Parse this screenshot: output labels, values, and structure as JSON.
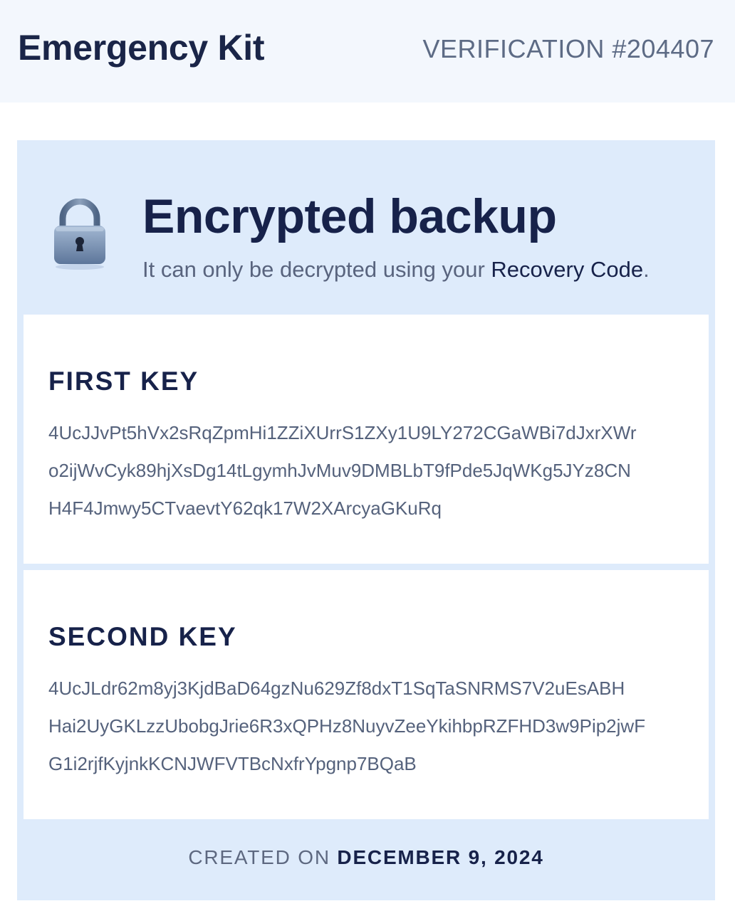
{
  "header": {
    "title": "Emergency Kit",
    "verification": "VERIFICATION #204407"
  },
  "backup": {
    "icon": "lock-icon",
    "title": "Encrypted backup",
    "subtitle_prefix": "It can only be decrypted using your ",
    "subtitle_emphasis": "Recovery Code",
    "subtitle_suffix": "."
  },
  "keys": [
    {
      "label": "FIRST KEY",
      "lines": [
        "4UcJJvPt5hVx2sRqZpmHi1ZZiXUrrS1ZXy1U9LY272CGaWBi7dJxrXWr",
        "o2ijWvCyk89hjXsDg14tLgymhJvMuv9DMBLbT9fPde5JqWKg5JYz8CN",
        "H4F4Jmwy5CTvaevtY62qk17W2XArcyaGKuRq"
      ]
    },
    {
      "label": "SECOND KEY",
      "lines": [
        "4UcJLdr62m8yj3KjdBaD64gzNu629Zf8dxT1SqTaSNRMS7V2uEsABH",
        "Hai2UyGKLzzUbobgJrie6R3xQPHz8NuyvZeeYkihbpRZFHD3w9Pip2jwF",
        "G1i2rjfKyjnkKCNJWFVTBcNxfrYpgnp7BQaB"
      ]
    }
  ],
  "footer": {
    "created_label": "CREATED ON ",
    "created_date": "DECEMBER 9, 2024"
  },
  "colors": {
    "header_bg": "#f3f7fd",
    "panel_bg": "#deebfb",
    "text_dark": "#17224a",
    "text_muted": "#5d6880"
  }
}
